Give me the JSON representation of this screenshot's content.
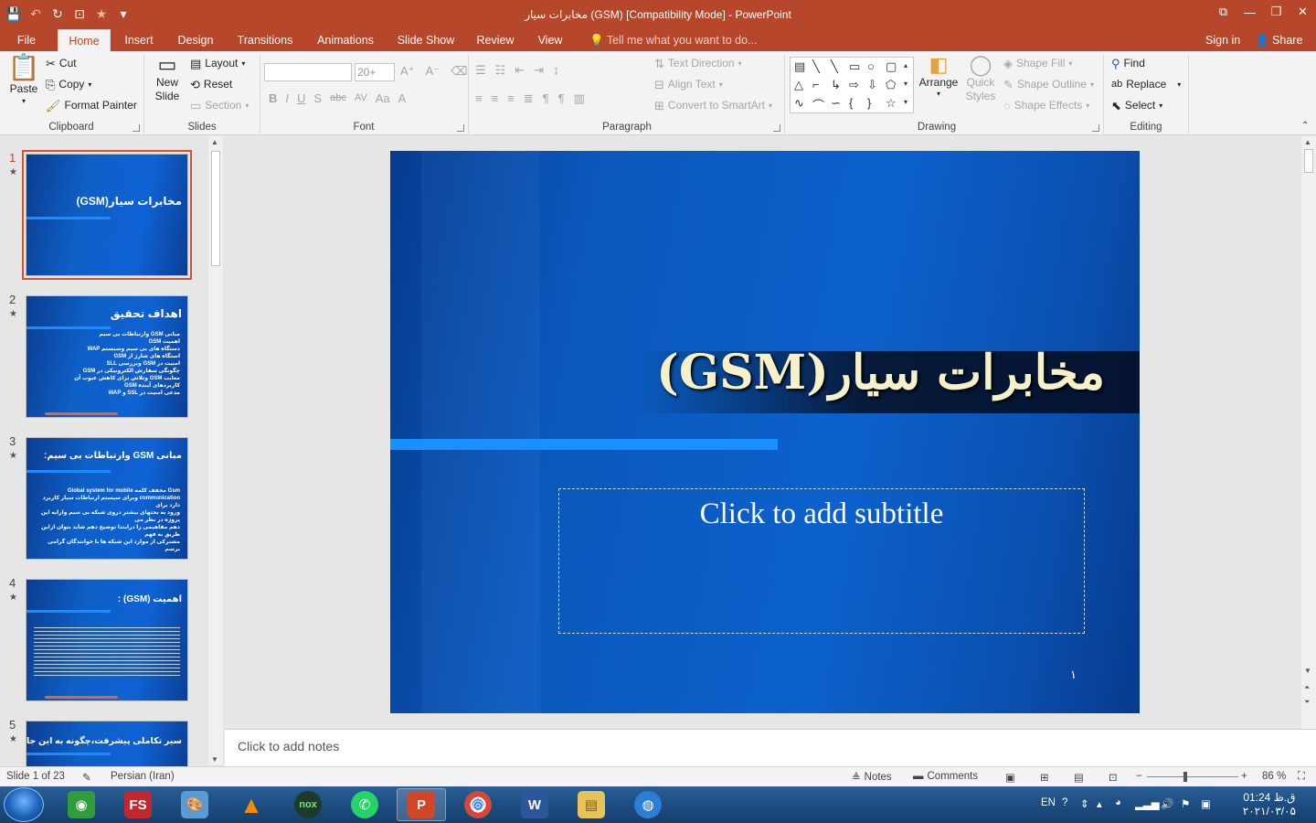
{
  "titlebar": {
    "title": "مخابرات سیار      (GSM) [Compatibility Mode] - PowerPoint",
    "qat": [
      {
        "icon": "save-icon",
        "glyph": "💾"
      },
      {
        "icon": "undo-icon",
        "glyph": "↶"
      },
      {
        "icon": "redo-icon",
        "glyph": "↻"
      },
      {
        "icon": "present-from-start-icon",
        "glyph": "⊡"
      },
      {
        "icon": "star-icon",
        "glyph": "★"
      },
      {
        "icon": "customize-qat-icon",
        "glyph": "▾"
      }
    ],
    "window_controls": {
      "restore_ribbon": "⧉",
      "minimize": "—",
      "maximize": "❐",
      "close": "✕"
    }
  },
  "tabs": [
    {
      "label": "File"
    },
    {
      "label": "Home"
    },
    {
      "label": "Insert"
    },
    {
      "label": "Design"
    },
    {
      "label": "Transitions"
    },
    {
      "label": "Animations"
    },
    {
      "label": "Slide Show"
    },
    {
      "label": "Review"
    },
    {
      "label": "View"
    }
  ],
  "active_tab": "Home",
  "tell_me": "Tell me what you want to do...",
  "sign_in": "Sign in",
  "share": "Share",
  "ribbon": {
    "clipboard": {
      "paste": "Paste",
      "cut": "Cut",
      "copy": "Copy",
      "format_painter": "Format Painter",
      "label": "Clipboard"
    },
    "slides": {
      "new_slide_1": "New",
      "new_slide_2": "Slide",
      "layout": "Layout",
      "reset": "Reset",
      "section": "Section",
      "label": "Slides"
    },
    "font": {
      "font_name": "",
      "font_size": "20+",
      "bold": "B",
      "italic": "I",
      "underline": "U",
      "shadow": "S",
      "strike": "abc",
      "spacing": "AV",
      "case": "Aa",
      "label": "Font"
    },
    "paragraph": {
      "text_direction": "Text Direction",
      "align_text": "Align Text",
      "smartart": "Convert to SmartArt",
      "label": "Paragraph"
    },
    "drawing": {
      "arrange": "Arrange",
      "quick_styles_1": "Quick",
      "quick_styles_2": "Styles",
      "shape_fill": "Shape Fill",
      "shape_outline": "Shape Outline",
      "shape_effects": "Shape Effects",
      "label": "Drawing"
    },
    "editing": {
      "find": "Find",
      "replace": "Replace",
      "select": "Select",
      "label": "Editing"
    }
  },
  "thumbnails": [
    {
      "num": "1",
      "title": "مخابرات سیار(GSM)",
      "lines": []
    },
    {
      "num": "2",
      "title": "اهداف تحقیق",
      "lines": [
        "مبانی GSM وارتباطات بی سیم",
        "اهمیت GSM",
        "دستگاه های بی سیم وسیستم WAP",
        "استگاه های شارژ از GSM",
        "امنیت در GSM وبررسی SLL",
        "چگونگی سفارش الکترونیکی در GSM",
        "معایب GSM وتلاش برای کاهش عیوب آن",
        "کاربردهای آینده GSM",
        "مدعی امنیت در SSL و WAP"
      ]
    },
    {
      "num": "3",
      "title": "مبانی GSM وارتباطات بی سیم:",
      "lines": [
        "Gsm مخفف کلمه Global system for mobile",
        "communication وبرای سیستم ارتباطات سیار کاربرد دارد برای",
        "ورود به بحثهای بیشتر دروی شبکه بی سیم وارایه این پروژه در نظر می",
        "دهم مفاهیمی را درابتدا توضیح دهم شاید بتوان ازاین طریق به فهم",
        "مشترکی از موارد این شبکه ها با خوانندگان گرامی برسم"
      ]
    },
    {
      "num": "4",
      "title": "اهمیت (GSM) :",
      "lines": []
    },
    {
      "num": "5",
      "title": "سیر تکاملی پیشرفت،چگونه به این جارسیدیم ؟",
      "lines": []
    }
  ],
  "slide": {
    "title": "(GSM)مخابرات سیار",
    "subtitle": "Click to add subtitle",
    "page_number": "١"
  },
  "notes_placeholder": "Click to add notes",
  "status": {
    "slide_of": "Slide 1 of 23",
    "language": "Persian (Iran)",
    "notes": "Notes",
    "comments": "Comments",
    "zoom": "86 %"
  },
  "taskbar": {
    "apps": [
      {
        "name": "internet-download-manager",
        "glyph": "◉",
        "color": "#2e9d3a"
      },
      {
        "name": "faststone",
        "glyph": "FS",
        "color": "#c1272d"
      },
      {
        "name": "paint",
        "glyph": "🎨",
        "color": "#5a9bd4"
      },
      {
        "name": "vlc",
        "glyph": "▲",
        "color": "#f08a00"
      },
      {
        "name": "nox",
        "glyph": "nox",
        "color": "#1e3a2a"
      },
      {
        "name": "whatsapp",
        "glyph": "✆",
        "color": "#25d366"
      },
      {
        "name": "powerpoint",
        "glyph": "P",
        "color": "#d24726"
      },
      {
        "name": "chrome",
        "glyph": "◎",
        "color": "#db4437"
      },
      {
        "name": "word",
        "glyph": "W",
        "color": "#2b579a"
      },
      {
        "name": "file-explorer",
        "glyph": "▤",
        "color": "#e8c25a"
      },
      {
        "name": "audio",
        "glyph": "◍",
        "color": "#2a7fd4"
      }
    ],
    "lang": "EN",
    "time": "01:24 ق.ظ",
    "date": "۲۰۲۱/۰۳/۰۵"
  },
  "colors": {
    "accent": "#b7472a",
    "slide_blue": "#0c61cc",
    "title_text": "#f6f1c9"
  }
}
